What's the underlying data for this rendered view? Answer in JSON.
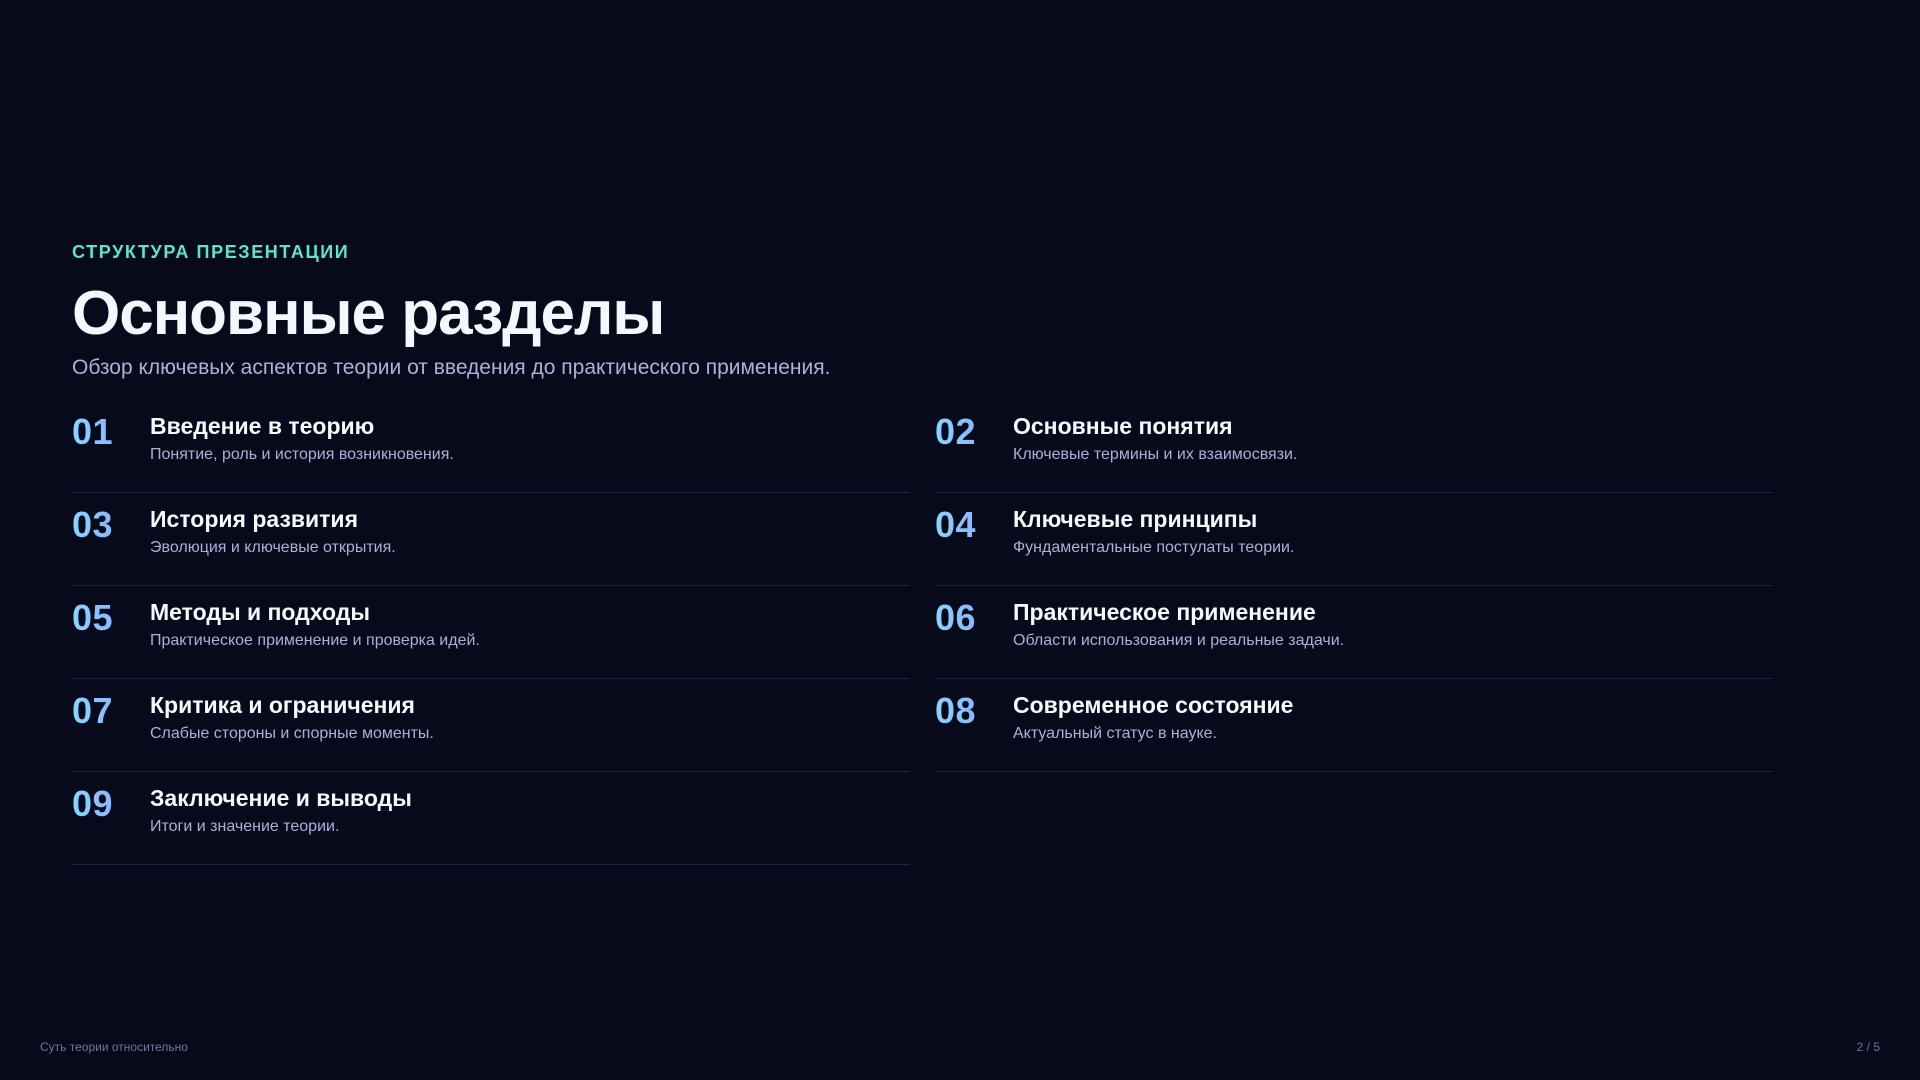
{
  "slide": {
    "eyebrow": "СТРУКТУРА ПРЕЗЕНТАЦИИ",
    "title": "Основные разделы",
    "subtitle": "Обзор ключевых аспектов теории от введения до практического применения."
  },
  "sections": [
    {
      "number": "01",
      "title": "Введение в теорию",
      "description": "Понятие, роль и история возникновения."
    },
    {
      "number": "02",
      "title": "Основные понятия",
      "description": "Ключевые термины и их взаимосвязи."
    },
    {
      "number": "03",
      "title": "История развития",
      "description": "Эволюция и ключевые открытия."
    },
    {
      "number": "04",
      "title": "Ключевые принципы",
      "description": "Фундаментальные постулаты теории."
    },
    {
      "number": "05",
      "title": "Методы и подходы",
      "description": "Практическое применение и проверка идей."
    },
    {
      "number": "06",
      "title": "Практическое применение",
      "description": "Области использования и реальные задачи."
    },
    {
      "number": "07",
      "title": "Критика и ограничения",
      "description": "Слабые стороны и спорные моменты."
    },
    {
      "number": "08",
      "title": "Современное состояние",
      "description": "Актуальный статус в науке."
    },
    {
      "number": "09",
      "title": "Заключение и выводы",
      "description": "Итоги и значение теории."
    }
  ],
  "footer": {
    "left_text": "Суть теории относительно",
    "page_indicator": "2 / 5"
  },
  "colors": {
    "background": "#070a1b",
    "accent_teal": "#5ee4c8",
    "number_gradient_start": "#88d6ff",
    "number_gradient_end": "#8b9cff"
  }
}
